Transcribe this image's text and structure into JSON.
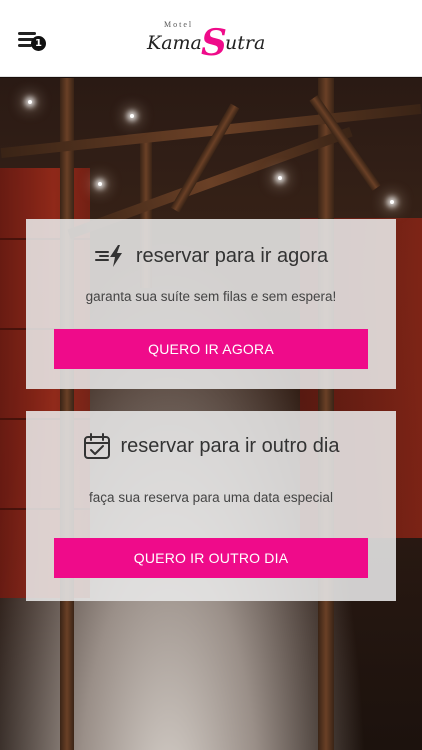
{
  "header": {
    "menu_badge": "1",
    "logo_small": "Motel",
    "logo_name_left": "Kama",
    "logo_s": "S",
    "logo_name_right": "utra"
  },
  "cards": [
    {
      "icon": "fast-lightning-icon",
      "title": "reservar para ir agora",
      "description": "garanta sua suíte sem filas e sem espera!",
      "button": "QUERO IR AGORA"
    },
    {
      "icon": "calendar-check-icon",
      "title": "reservar para ir outro dia",
      "description": "faça sua reserva para uma data especial",
      "button": "QUERO IR OUTRO DIA"
    }
  ],
  "colors": {
    "accent": "#ef0b8a",
    "header_bg": "#ffffff",
    "card_bg": "#e8e8e8"
  }
}
